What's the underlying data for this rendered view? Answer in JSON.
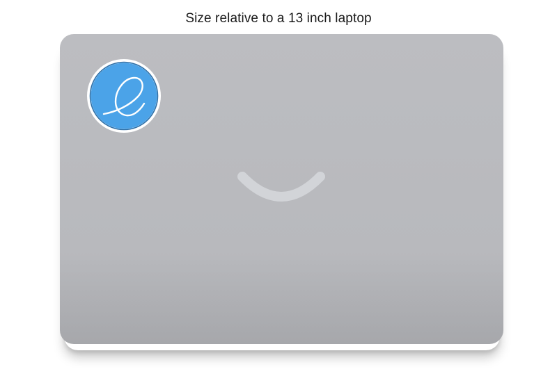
{
  "caption": "Size relative to a 13 inch laptop",
  "icons": {
    "sticker": "elementary-os-logo-icon",
    "lid_logo": "smile-logo-icon"
  },
  "colors": {
    "lid": "#b9babe",
    "sticker_blue": "#4ba3e8",
    "sticker_border": "#ffffff",
    "smile": "#d2d4d8"
  }
}
